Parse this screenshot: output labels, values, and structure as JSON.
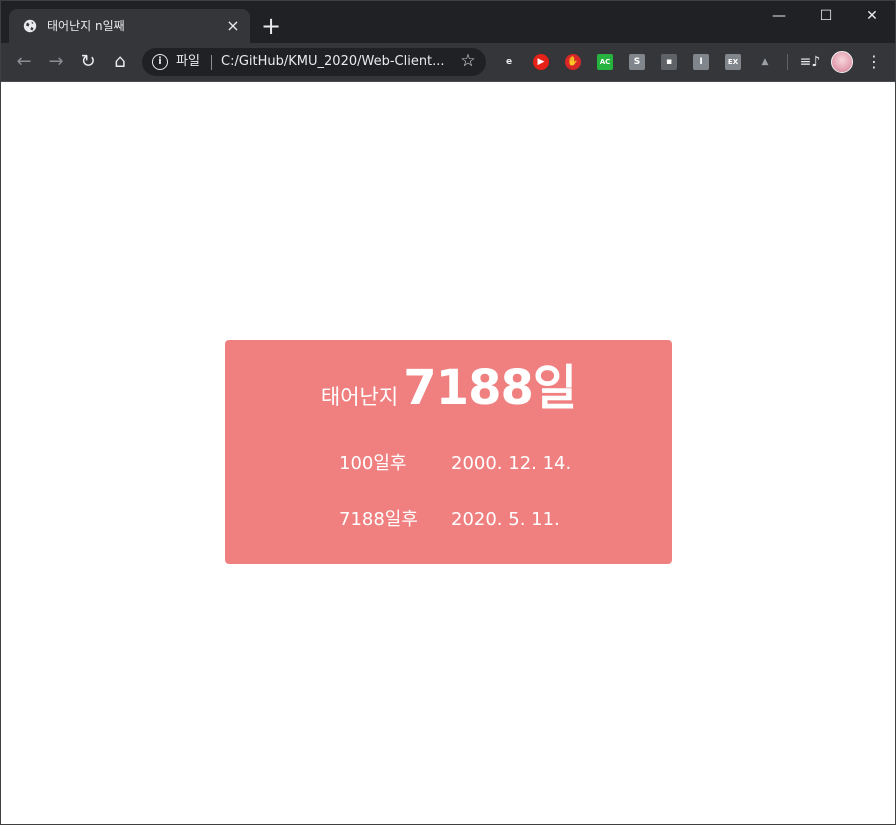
{
  "browser": {
    "tab": {
      "title": "태어난지 n일째",
      "close_icon": "close-icon",
      "favicon": "globe-icon"
    },
    "new_tab_label": "+",
    "window_controls": {
      "minimize": "—",
      "maximize": "☐",
      "close": "✕"
    },
    "toolbar": {
      "back": "←",
      "forward": "→",
      "reload": "↻",
      "home": "⌂"
    },
    "omnibox": {
      "scheme_label": "파일",
      "url": "C:/GitHub/KMU_2020/Web-Client..."
    },
    "extensions": [
      {
        "name": "extension-e-icon",
        "glyph": "e",
        "color": "#35363a",
        "text_color": "#e8eaed"
      },
      {
        "name": "extension-youtube-icon",
        "glyph": "▶",
        "color": "#e62117",
        "text_color": "#ffffff"
      },
      {
        "name": "extension-stop-hand-icon",
        "glyph": "✋",
        "color": "#d92626",
        "text_color": "#ffffff"
      },
      {
        "name": "extension-ac-icon",
        "glyph": "AC",
        "color": "#27b33f",
        "text_color": "#ffffff"
      },
      {
        "name": "extension-s-icon",
        "glyph": "S",
        "color": "#80868b",
        "text_color": "#ffffff"
      },
      {
        "name": "extension-card-icon",
        "glyph": "▪",
        "color": "#5f6368",
        "text_color": "#ffffff"
      },
      {
        "name": "extension-i-icon",
        "glyph": "I",
        "color": "#80868b",
        "text_color": "#ffffff"
      },
      {
        "name": "extension-ex-icon",
        "glyph": "EX",
        "color": "#80868b",
        "text_color": "#ffffff"
      },
      {
        "name": "extension-drive-icon",
        "glyph": "▲",
        "color": "#35363a",
        "text_color": "#9aa0a6"
      }
    ],
    "media_icon": "≡♪",
    "menu_glyph": "⋮",
    "colors": {
      "frame": "#202124",
      "toolbar": "#35363a",
      "omnibox": "#202124"
    }
  },
  "page": {
    "headline_label": "태어난지",
    "headline_count": "7188일",
    "rows": [
      {
        "label": "100일후",
        "date": "2000. 12. 14."
      },
      {
        "label": "7188일후",
        "date": "2020. 5. 11."
      }
    ],
    "card_color": "#f08080"
  }
}
